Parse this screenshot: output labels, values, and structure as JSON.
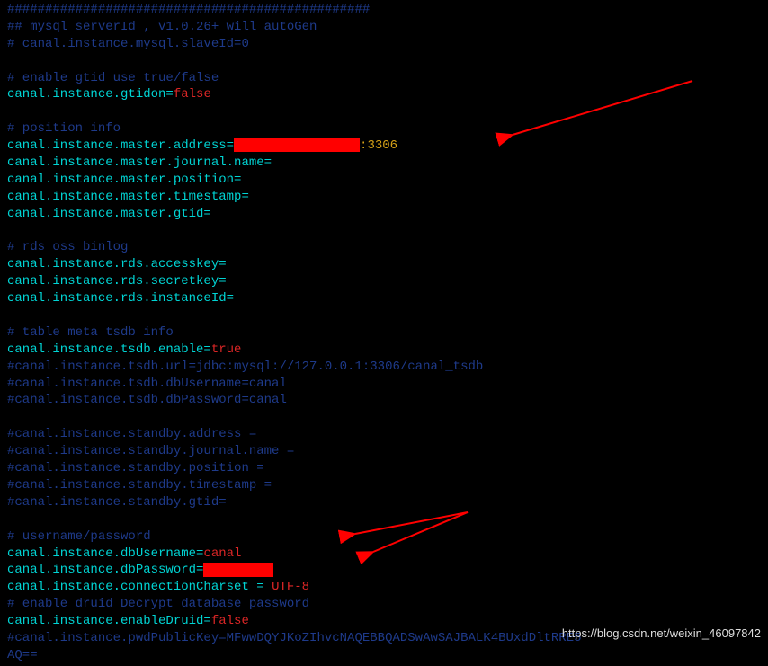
{
  "lines": {
    "hashes": "################################################",
    "c1": "## mysql serverId , v1.0.26+ will autoGen",
    "c2": "# canal.instance.mysql.slaveId=0",
    "c3": "# enable gtid use true/false",
    "k_gtid": "canal.instance.gtidon=",
    "v_gtid": "false",
    "c4": "# position info",
    "k_addr": "canal.instance.master.address=",
    "v_addr_port": ":3306",
    "k_jname": "canal.instance.master.journal.name=",
    "k_pos": "canal.instance.master.position=",
    "k_ts": "canal.instance.master.timestamp=",
    "k_mgtid": "canal.instance.master.gtid=",
    "c5": "# rds oss binlog",
    "k_ak": "canal.instance.rds.accesskey=",
    "k_sk": "canal.instance.rds.secretkey=",
    "k_iid": "canal.instance.rds.instanceId=",
    "c6": "# table meta tsdb info",
    "k_tsdb": "canal.instance.tsdb.enable=",
    "v_tsdb": "true",
    "c7": "#canal.instance.tsdb.url=jdbc:mysql://127.0.0.1:3306/canal_tsdb",
    "c8": "#canal.instance.tsdb.dbUsername=canal",
    "c9": "#canal.instance.tsdb.dbPassword=canal",
    "c10": "#canal.instance.standby.address =",
    "c11": "#canal.instance.standby.journal.name =",
    "c12": "#canal.instance.standby.position =",
    "c13": "#canal.instance.standby.timestamp =",
    "c14": "#canal.instance.standby.gtid=",
    "c15": "# username/password",
    "k_user": "canal.instance.dbUsername=",
    "v_user": "canal",
    "k_pass": "canal.instance.dbPassword=",
    "k_charset": "canal.instance.connectionCharset = ",
    "v_charset": "UTF-8",
    "c16": "# enable druid Decrypt database password",
    "k_druid": "canal.instance.enableDruid=",
    "v_druid": "false",
    "c17": "#canal.instance.pwdPublicKey=MFwwDQYJKoZIhvcNAQEBBQADSwAwSAJBALK4BUxdDltRRE5",
    "c18": "AQ=="
  },
  "watermark": "https://blog.csdn.net/weixin_46097842"
}
